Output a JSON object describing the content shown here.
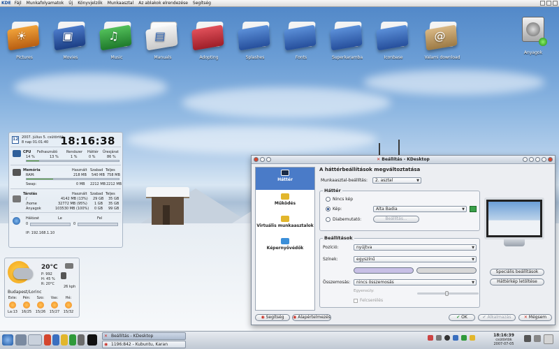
{
  "menubar": {
    "logo": "KDE",
    "items": [
      "Fájl",
      "Munkafolyamatok",
      "Új",
      "Könyvjelzők",
      "Munkaasztal",
      "Az ablakok elrendezése",
      "Segítség"
    ]
  },
  "desktop_icons": [
    {
      "label": "Pictures",
      "icon": "pictures-folder-icon",
      "color": "#e08a24"
    },
    {
      "label": "Movies",
      "icon": "movies-folder-icon",
      "color": "#2c5aa8"
    },
    {
      "label": "Music",
      "icon": "music-folder-icon",
      "color": "#2f9a3a"
    },
    {
      "label": "Manuals",
      "icon": "manuals-folder-icon",
      "color": "#e4e4e4"
    },
    {
      "label": "Adopting",
      "icon": "adopting-folder-icon",
      "color": "#c8323c"
    },
    {
      "label": "Splashes",
      "icon": "splashes-folder-icon",
      "color": "#3a6fbf"
    },
    {
      "label": "Fonts",
      "icon": "fonts-folder-icon",
      "color": "#3a6fbf"
    },
    {
      "label": "Superkaramba",
      "icon": "superkaramba-folder-icon",
      "color": "#3a6fbf"
    },
    {
      "label": "Iconbase",
      "icon": "iconbase-folder-icon",
      "color": "#3a6fbf"
    },
    {
      "label": "Valami download",
      "icon": "download-folder-icon",
      "color": "#c8a46a"
    },
    {
      "label": "Anyagok",
      "icon": "harddisk-icon",
      "color": "#888888"
    }
  ],
  "sysinfo": {
    "date": "2007. július 5. csütörtök",
    "uptime": "8 nap 01:01:40",
    "calendar_day": "12",
    "time": "18:16:38",
    "cpu": {
      "label": "CPU",
      "headers": [
        "Felhasználó",
        "Rendszer",
        "Háttér",
        "Üresjárat"
      ],
      "values": [
        "14 %",
        "13 %",
        "1 %",
        "0 %",
        "86 %"
      ],
      "load": 0.14
    },
    "memory": {
      "label": "Memória",
      "headers": [
        "Használt",
        "Szabad",
        "Teljes"
      ],
      "ram": {
        "label": "RAM:",
        "values": [
          "218 MB",
          "540 MB",
          "758 MB"
        ],
        "load": 0.29
      },
      "swap": {
        "label": "Swap:",
        "values": [
          "0 MB",
          "2212 MB",
          "2212 MB"
        ],
        "load": 0.0
      }
    },
    "storage": {
      "label": "Tárolás",
      "headers": [
        "Használt",
        "Szabad",
        "Teljes"
      ],
      "rows": [
        {
          "name": "/",
          "used": "4142 MB (13%)",
          "free": "29 GB",
          "total": "35 GB"
        },
        {
          "name": "/home",
          "used": "32772 MB (95%)",
          "free": "1 GB",
          "total": "35 GB"
        },
        {
          "name": "Anyagok",
          "used": "103530 MB (100%)",
          "free": "0 GB",
          "total": "99 GB"
        }
      ]
    },
    "network": {
      "label": "Hálózat",
      "down_label": "Le",
      "up_label": "Fel",
      "down_value": "0",
      "up_value": "0",
      "ip": "IP: 192.168.1.10"
    }
  },
  "weather": {
    "temp": "20°C",
    "p": "P: 992",
    "h": "H: 45 %",
    "r": "R: 20°C",
    "wind": "26 kph",
    "location": "Budapest/Lorinc",
    "forecast": [
      {
        "day": "Este:",
        "temp": "La:13"
      },
      {
        "day": "Pén:",
        "temp": "16/25"
      },
      {
        "day": "Szo:",
        "temp": "15/26"
      },
      {
        "day": "Vas:",
        "temp": "15/27"
      },
      {
        "day": "Hé:",
        "temp": "15/32"
      }
    ]
  },
  "dialog": {
    "title": "Beállítás - KDesktop",
    "nav": [
      {
        "label": "Háttér",
        "icon": "background-monitor-icon",
        "active": true
      },
      {
        "label": "Működés",
        "icon": "behavior-icon",
        "active": false
      },
      {
        "label": "Virtuális munkaasztalok",
        "icon": "virtual-desktops-icon",
        "active": false
      },
      {
        "label": "Képernyővédők",
        "icon": "screensaver-icon",
        "active": false
      }
    ],
    "heading": "A háttérbeállítások megváltoztatása",
    "desktop_setting_label": "Munkaasztal-beállítás:",
    "desktop_setting_value": "2. asztal",
    "background_group": "Háttér",
    "radio_no_image": "Nincs kép",
    "radio_image": "Kép:",
    "image_value": "Alta Badia",
    "radio_slideshow": "Diabemutató:",
    "slideshow_button": "Beállítás...",
    "settings_group": "Beállítások",
    "position_label": "Pozíció:",
    "position_value": "nyújtva",
    "colors_label": "Színek:",
    "colors_value": "egyszínű",
    "blending_label": "Összemosás:",
    "blending_value": "nincs összemosás",
    "balance_label": "Egyensúly:",
    "reverse_label": "Felcserélés",
    "color1": "#c8c0e6",
    "color2": "#d8d8d8",
    "advanced_button": "Speciális beállítások",
    "download_button": "Háttérkép letöltése",
    "help_button": "Segítség",
    "defaults_button": "Alapértelmezés",
    "ok_button": "OK",
    "apply_button": "Alkalmazás",
    "cancel_button": "Mégsem"
  },
  "taskbar": {
    "tasks": [
      {
        "label": "Beállítás - KDesktop",
        "active": true
      },
      {
        "label": "1196:842 - Kubuntu, Karan",
        "active": false
      }
    ],
    "clock_time": "18:16:39",
    "clock_day": "csütörtök",
    "clock_date": "2007-07-05"
  }
}
